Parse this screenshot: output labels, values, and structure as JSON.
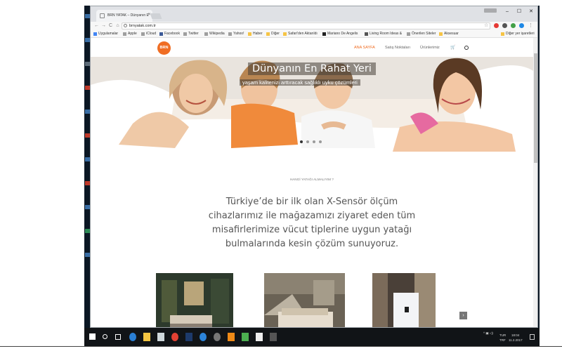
{
  "browser": {
    "tab_title": "BRN YATAK – Dünyanın E",
    "address": "brnyatak.com.tr",
    "user_chip": "",
    "win_minimize": "–",
    "win_maximize": "☐",
    "win_close": "✕",
    "nav_back": "←",
    "nav_forward": "→",
    "nav_reload": "C",
    "nav_home": "⌂",
    "star": "☆"
  },
  "bookmarks": [
    {
      "label": "Uygulamalar",
      "color": "#4285f4"
    },
    {
      "label": "Apple",
      "color": "#9e9e9e"
    },
    {
      "label": "iCloud",
      "color": "#9e9e9e"
    },
    {
      "label": "Facebook",
      "color": "#3b5998"
    },
    {
      "label": "Twitter",
      "color": "#9e9e9e"
    },
    {
      "label": "Wikipedia",
      "color": "#9e9e9e"
    },
    {
      "label": "Yahoo!",
      "color": "#9e9e9e"
    },
    {
      "label": "Haber",
      "color": "#f6c445"
    },
    {
      "label": "Diğer",
      "color": "#f6c445"
    },
    {
      "label": "Safari'den Aktarıldı",
      "color": "#f6c445"
    },
    {
      "label": "Mariano De Angelis",
      "color": "#222222"
    },
    {
      "label": "Living Room Ideas &",
      "color": "#555555"
    },
    {
      "label": "Önerilen Siteler",
      "color": "#9e9e9e"
    },
    {
      "label": "Aksesuar",
      "color": "#f6c445"
    },
    {
      "label": "Diğer yer işaretleri",
      "color": "#f6c445"
    }
  ],
  "site": {
    "logo": "BRN",
    "menu": [
      "ANA SAYFA",
      "Satış Noktaları",
      "Ürünlerimiz"
    ],
    "accent": "#f06d23"
  },
  "hero": {
    "title": "Dünyanın En Rahat Yeri",
    "subtitle": "yaşam kalitenizi arttıracak sağlıklı uyku çözümleri",
    "slide_count": 4,
    "active_slide": 1
  },
  "content": {
    "kicker": "HANGİ YATAĞI ALMALIYIM ?",
    "intro": "Türkiye’de bir ilk olan X-Sensör ölçüm cihazlarımız ile mağazamızı ziyaret eden tüm misafirlerimize vücut tiplerine uygun yatağı bulmalarında kesin çözüm sunuyoruz.",
    "next_arrow": "›"
  },
  "taskbar": {
    "lang": "TUR",
    "lang2": "TRF",
    "time": "18:04",
    "date": "11.2.2017"
  },
  "icons": {
    "start": "windows-logo-icon",
    "search": "search-icon",
    "task_view": "task-view-icon",
    "edge": "edge-browser-icon",
    "explorer": "file-explorer-icon",
    "store": "store-icon",
    "chrome": "chrome-icon",
    "photoshop": "photoshop-icon"
  }
}
